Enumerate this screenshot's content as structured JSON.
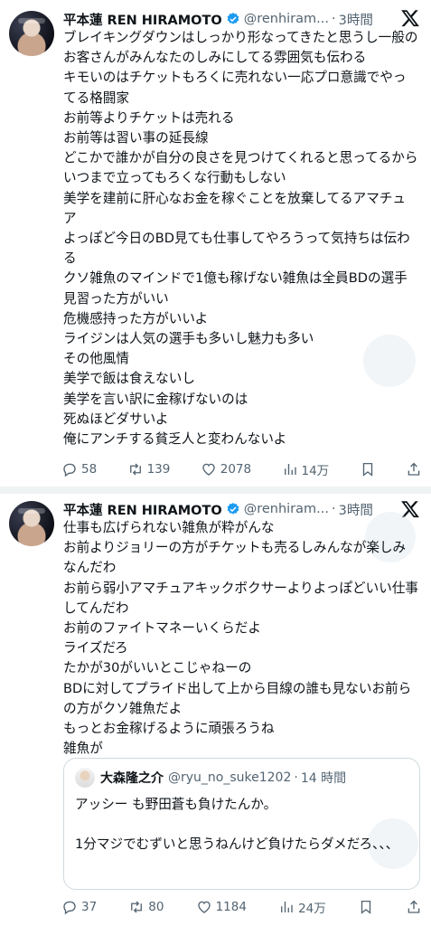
{
  "tweets": [
    {
      "author_name": "平本蓮 REN HIRAMOTO",
      "handle": "@renhiram...",
      "time": "3時間",
      "lines": [
        "ブレイキングダウンはしっかり形なってきたと思うし一般のお客さんがみんなたのしみにしてる雰囲気も伝わる",
        "キモいのはチケットもろくに売れない一応プロ意識でやってる格闘家",
        "お前等よりチケットは売れる",
        "お前等は習い事の延長線",
        "どこかで誰かが自分の良さを見つけてくれると思ってるからいつまで立ってもろくな行動もしない",
        "美学を建前に肝心なお金を稼ぐことを放棄してるアマチュア",
        "よっぽど今日のBD見ても仕事してやろうって気持ちは伝わる",
        "クソ雑魚のマインドで1億も稼げない雑魚は全員BDの選手見習った方がいい",
        "危機感持った方がいいよ",
        "ライジンは人気の選手も多いし魅力も多い",
        "その他風情",
        "美学で飯は食えないし",
        "美学を言い訳に金稼げないのは",
        "死ぬほどダサいよ",
        "俺にアンチする貧乏人と変わんないよ"
      ],
      "stats": {
        "replies": "58",
        "retweets": "139",
        "likes": "2078",
        "views": "14万"
      }
    },
    {
      "author_name": "平本蓮 REN HIRAMOTO",
      "handle": "@renhiram...",
      "time": "3時間",
      "lines": [
        "仕事も広げられない雑魚が粋がんな",
        "お前よりジョリーの方がチケットも売るしみんなが楽しみなんだわ",
        "お前ら弱小アマチュアキックボクサーよりよっぽどいい仕事してんだわ",
        "お前のファイトマネーいくらだよ",
        "ライズだろ",
        "たかが30がいいとこじゃねーの",
        "BDに対してプライド出して上から目線の誰も見ないお前らの方がクソ雑魚だよ",
        "もっとお金稼げるように頑張ろうね",
        "雑魚が"
      ],
      "quote": {
        "author_name": "大森隆之介",
        "handle": "@ryu_no_suke1202",
        "time": "14 時間",
        "lines": [
          "アッシー も野田蒼も負けたんか。",
          "",
          "1分マジでむずいと思うねんけど負けたらダメだろ、、、"
        ]
      },
      "stats": {
        "replies": "37",
        "retweets": "80",
        "likes": "1184",
        "views": "24万"
      }
    }
  ],
  "colors": {
    "verified": "#1d9bf0",
    "muted": "#536471",
    "text": "#0f1419",
    "border": "#cfd9de"
  }
}
